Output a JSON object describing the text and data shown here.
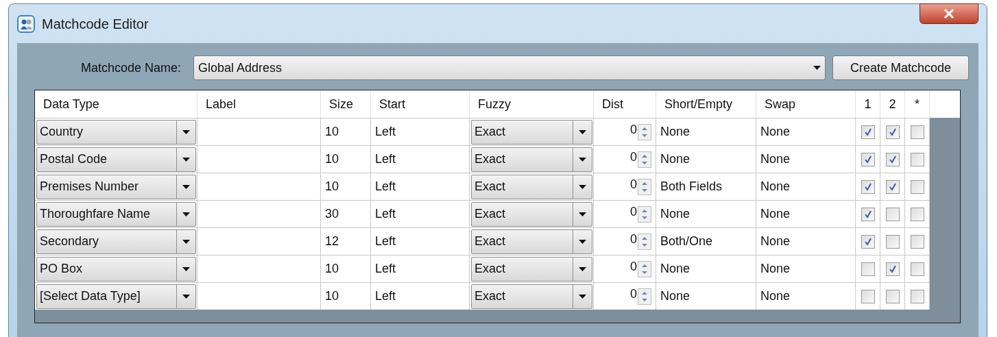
{
  "window": {
    "title": "Matchcode Editor"
  },
  "matchcode_name": {
    "label": "Matchcode Name:",
    "value": "Global Address"
  },
  "create_button": "Create Matchcode",
  "table": {
    "columns": [
      "Data Type",
      "Label",
      "Size",
      "Start",
      "Fuzzy",
      "Dist",
      "Short/Empty",
      "Swap",
      "1",
      "2",
      "*"
    ],
    "rows": [
      {
        "data_type": "Country",
        "size": "10",
        "start": "Left",
        "fuzzy": "Exact",
        "dist": "0",
        "short_empty": "None",
        "swap": "None",
        "checks": [
          true,
          true,
          false
        ]
      },
      {
        "data_type": "Postal Code",
        "size": "10",
        "start": "Left",
        "fuzzy": "Exact",
        "dist": "0",
        "short_empty": "None",
        "swap": "None",
        "checks": [
          true,
          true,
          false
        ]
      },
      {
        "data_type": "Premises Number",
        "size": "10",
        "start": "Left",
        "fuzzy": "Exact",
        "dist": "0",
        "short_empty": "Both Fields",
        "swap": "None",
        "checks": [
          true,
          true,
          false
        ]
      },
      {
        "data_type": "Thoroughfare Name",
        "size": "30",
        "start": "Left",
        "fuzzy": "Exact",
        "dist": "0",
        "short_empty": "None",
        "swap": "None",
        "checks": [
          true,
          false,
          false
        ]
      },
      {
        "data_type": "Secondary",
        "size": "12",
        "start": "Left",
        "fuzzy": "Exact",
        "dist": "0",
        "short_empty": "Both/One",
        "swap": "None",
        "checks": [
          true,
          false,
          false
        ]
      },
      {
        "data_type": "PO Box",
        "size": "10",
        "start": "Left",
        "fuzzy": "Exact",
        "dist": "0",
        "short_empty": "None",
        "swap": "None",
        "checks": [
          false,
          true,
          false
        ]
      },
      {
        "data_type": "[Select Data Type]",
        "size": "10",
        "start": "Left",
        "fuzzy": "Exact",
        "dist": "0",
        "short_empty": "None",
        "swap": "None",
        "checks": [
          false,
          false,
          false
        ]
      }
    ]
  }
}
